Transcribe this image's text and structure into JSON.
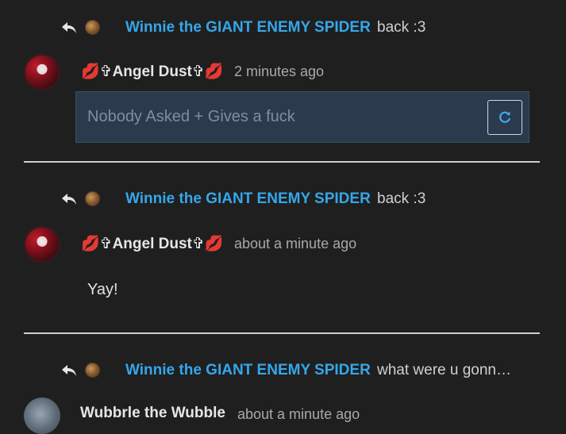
{
  "blocks": [
    {
      "reply": {
        "user": "Winnie the GIANT ENEMY SPIDER",
        "text": "back :3"
      },
      "author": "💋✞Angel Dust✞💋",
      "time": "2 minutes ago",
      "pending_message": "Nobody Asked + Gives a fuck"
    },
    {
      "reply": {
        "user": "Winnie the GIANT ENEMY SPIDER",
        "text": "back :3"
      },
      "author": "💋✞Angel Dust✞💋",
      "time": "about a minute ago",
      "message": "Yay!"
    },
    {
      "reply": {
        "user": "Winnie the GIANT ENEMY SPIDER",
        "text": "what were u gonn…"
      },
      "author": "Wubbrle the Wubble",
      "time": "about a minute ago"
    }
  ],
  "icons": {
    "reply": "reply-arrow-icon",
    "retry": "refresh-icon"
  },
  "colors": {
    "background": "#1f1f1f",
    "username_link": "#35a7ea",
    "pending_box": "#2b3b4d",
    "divider": "#cfcfcf"
  }
}
